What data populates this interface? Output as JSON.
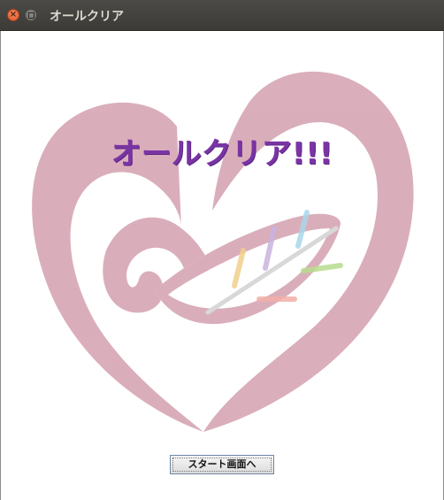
{
  "window": {
    "title": "オールクリア",
    "close_glyph": "×"
  },
  "main": {
    "headline": "オールクリア!!!",
    "start_button_label": "スタート画面へ"
  },
  "colors": {
    "titlebar": "#3c3b37",
    "headline": "#7a34a4",
    "heart": "#d8aab7"
  },
  "icons": {
    "logo": "heart-leaf-logo"
  }
}
